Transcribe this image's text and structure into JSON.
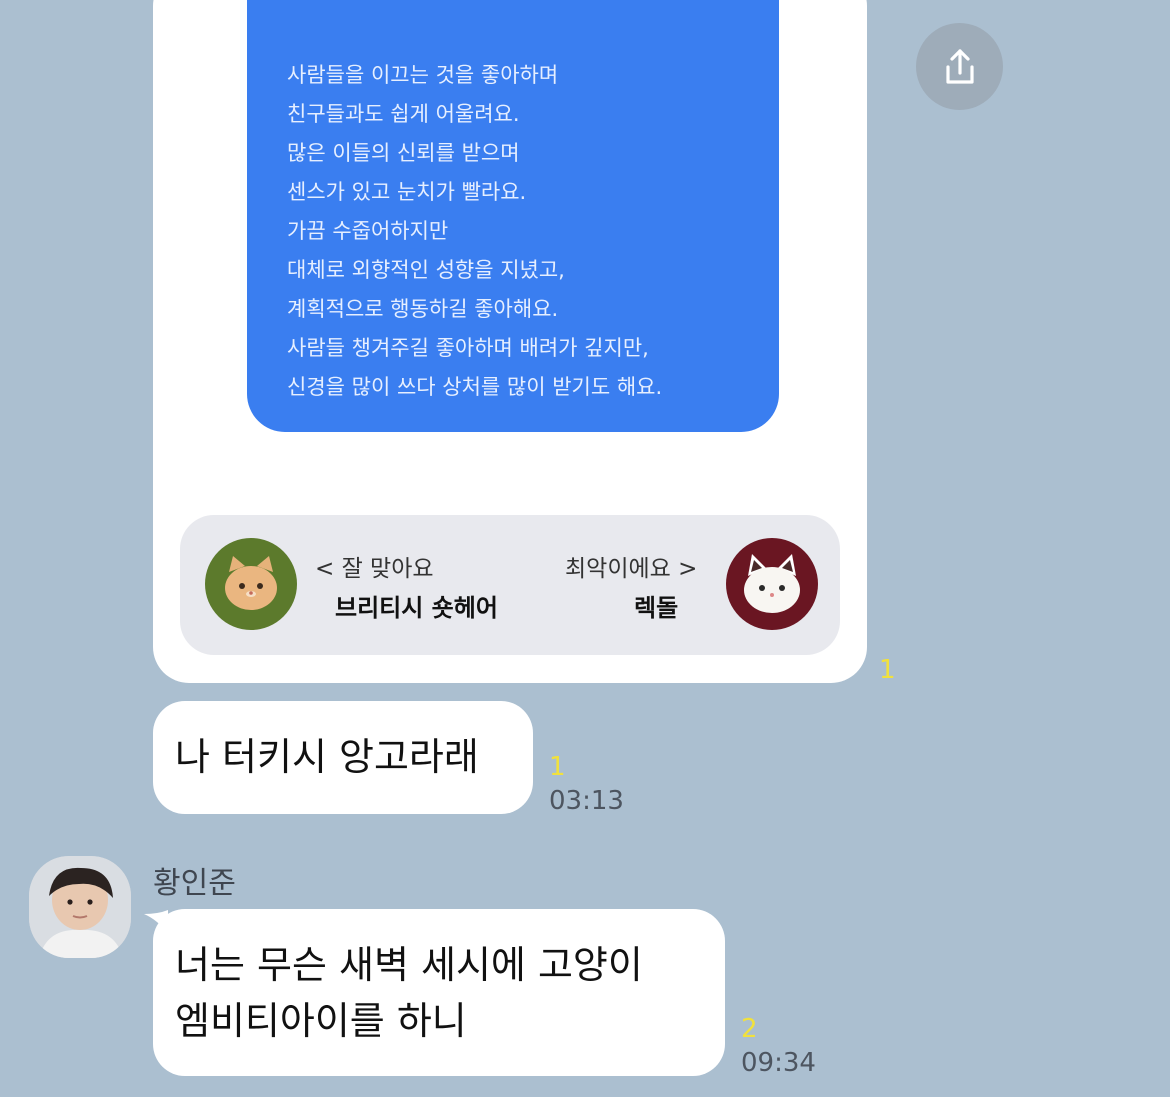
{
  "shared_image": {
    "title": "",
    "lines": [
      "사람들을 이끄는 것을 좋아하며",
      "친구들과도 쉽게 어울려요.",
      "많은 이들의 신뢰를 받으며",
      "센스가 있고 눈치가 빨라요.",
      "가끔 수줍어하지만",
      "대체로 외향적인 성향을 지녔고,",
      "계획적으로 행동하길 좋아해요.",
      "사람들 챙겨주길 좋아하며 배려가 깊지만,",
      "신경을 많이 쓰다 상처를 많이 받기도 해요."
    ],
    "good_match": {
      "caption": "< 잘 맞아요",
      "name": "브리티시 숏헤어"
    },
    "bad_match": {
      "caption": "최악이에요 >",
      "name": "렉돌"
    },
    "unread": "1"
  },
  "share_icon": "share-icon",
  "messages": [
    {
      "text": "나 터키시 앙고라래",
      "unread": "1",
      "time": "03:13"
    }
  ],
  "reply": {
    "sender": "황인준",
    "lines": [
      "너는 무슨 새벽 세시에 고양이",
      "엠비티아이를 하니"
    ],
    "unread": "2",
    "time": "09:34"
  },
  "colors": {
    "background": "#abbfd0",
    "unread": "#f1e13c",
    "panel_blue": "#3a7ef0"
  }
}
